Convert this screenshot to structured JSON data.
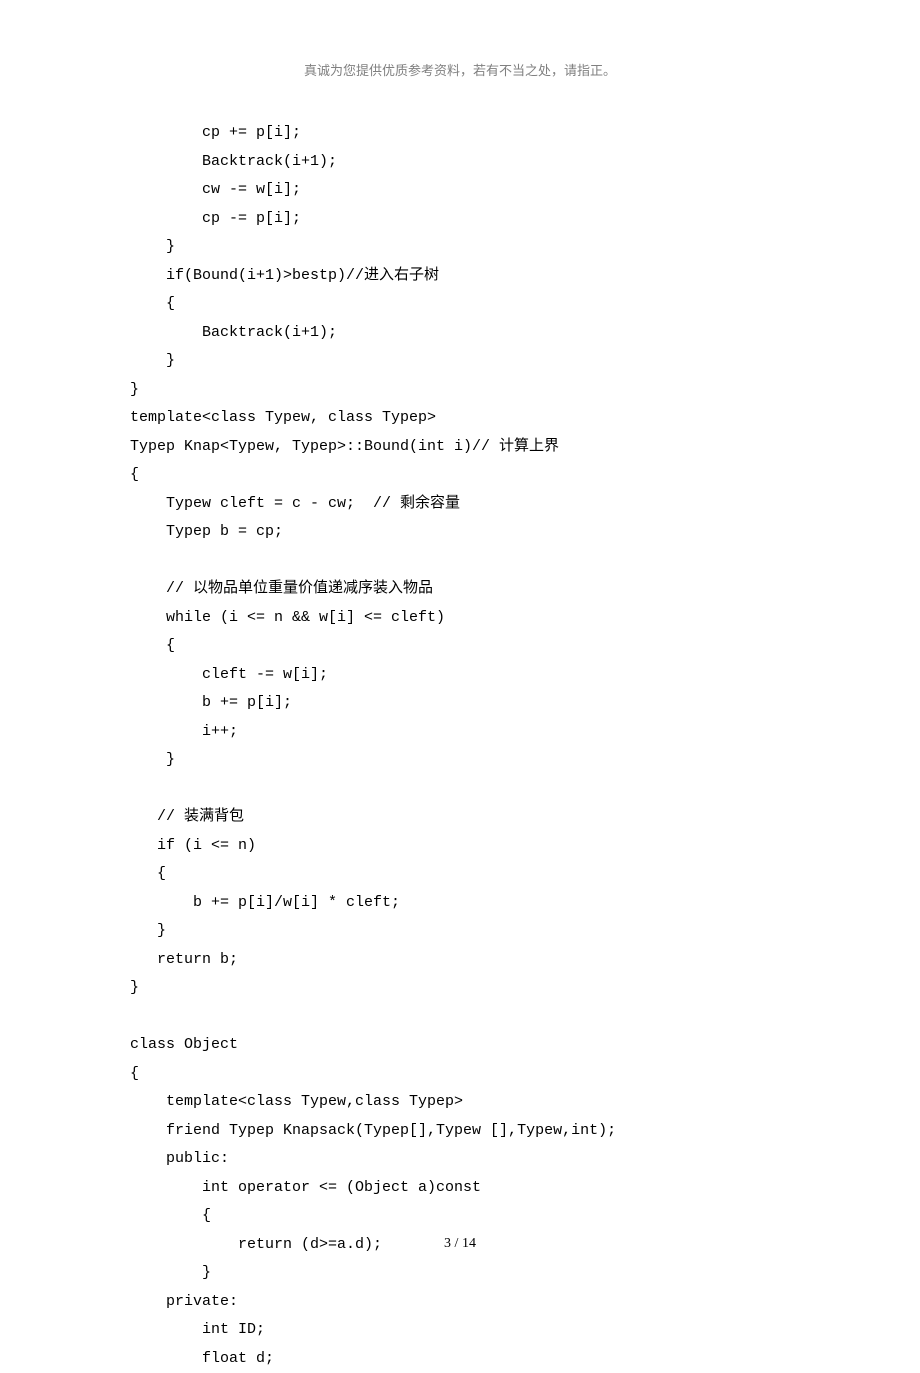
{
  "header": {
    "text": "真诚为您提供优质参考资料，若有不当之处，请指正。"
  },
  "code": {
    "lines": [
      "        cp += p[i];",
      "        Backtrack(i+1);",
      "        cw -= w[i];",
      "        cp -= p[i];",
      "    }",
      "    if(Bound(i+1)>bestp)//进入右子树",
      "    {",
      "        Backtrack(i+1);",
      "    }",
      "}",
      "template<class Typew, class Typep>",
      "Typep Knap<Typew, Typep>::Bound(int i)// 计算上界",
      "{",
      "    Typew cleft = c - cw;  // 剩余容量",
      "    Typep b = cp;",
      "",
      "    // 以物品单位重量价值递减序装入物品",
      "    while (i <= n && w[i] <= cleft)",
      "    {",
      "        cleft -= w[i];",
      "        b += p[i];",
      "        i++;",
      "    }",
      "",
      "   // 装满背包",
      "   if (i <= n)",
      "   {",
      "       b += p[i]/w[i] * cleft;",
      "   }",
      "   return b;",
      "}",
      "",
      "class Object",
      "{",
      "    template<class Typew,class Typep>",
      "    friend Typep Knapsack(Typep[],Typew [],Typew,int);",
      "    public:",
      "        int operator <= (Object a)const",
      "        {",
      "            return (d>=a.d);",
      "        }",
      "    private:",
      "        int ID;",
      "        float d;"
    ]
  },
  "footer": {
    "page_current": "3",
    "page_separator": " / ",
    "page_total": "14"
  }
}
